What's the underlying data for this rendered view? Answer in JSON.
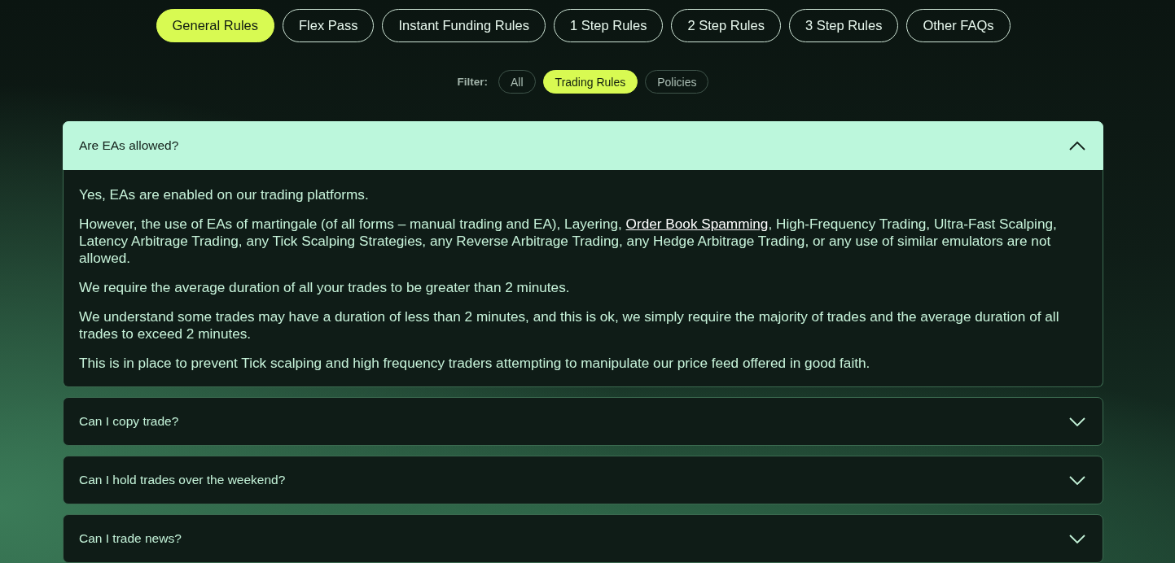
{
  "tabs": [
    {
      "label": "General Rules",
      "selected": true
    },
    {
      "label": "Flex Pass",
      "selected": false
    },
    {
      "label": "Instant Funding Rules",
      "selected": false
    },
    {
      "label": "1 Step Rules",
      "selected": false
    },
    {
      "label": "2 Step Rules",
      "selected": false
    },
    {
      "label": "3 Step Rules",
      "selected": false
    },
    {
      "label": "Other FAQs",
      "selected": false
    }
  ],
  "filter": {
    "label": "Filter:",
    "options": [
      {
        "label": "All",
        "selected": false
      },
      {
        "label": "Trading Rules",
        "selected": true
      },
      {
        "label": "Policies",
        "selected": false
      }
    ]
  },
  "faqs": [
    {
      "question": "Are EAs allowed?",
      "expanded": true,
      "answer": [
        {
          "segments": [
            {
              "kind": "text",
              "text": "Yes, EAs are enabled on our trading platforms."
            }
          ]
        },
        {
          "segments": [
            {
              "kind": "text",
              "text": "However, the use of EAs of martingale (of all forms – manual trading and EA), Layering, "
            },
            {
              "kind": "link",
              "text": "Order Book Spamming"
            },
            {
              "kind": "text",
              "text": ", High-Frequency Trading, Ultra-Fast Scalping, Latency Arbitrage Trading, any Tick Scalping Strategies, any Reverse Arbitrage Trading, any Hedge Arbitrage Trading, or any use of similar emulators are not allowed."
            }
          ]
        },
        {
          "segments": [
            {
              "kind": "text",
              "text": "We require the average duration of all your trades to be greater than 2 minutes."
            }
          ]
        },
        {
          "segments": [
            {
              "kind": "text",
              "text": "We understand some trades may have a duration of less than 2 minutes, and this is ok, we simply require the majority of trades and the average duration of all trades to exceed 2 minutes."
            }
          ]
        },
        {
          "segments": [
            {
              "kind": "text",
              "text": "This is in place to prevent Tick scalping and high frequency traders attempting to manipulate our price feed offered in good faith."
            }
          ]
        }
      ]
    },
    {
      "question": "Can I copy trade?",
      "expanded": false
    },
    {
      "question": "Can I hold trades over the weekend?",
      "expanded": false
    },
    {
      "question": "Can I trade news?",
      "expanded": false
    }
  ]
}
